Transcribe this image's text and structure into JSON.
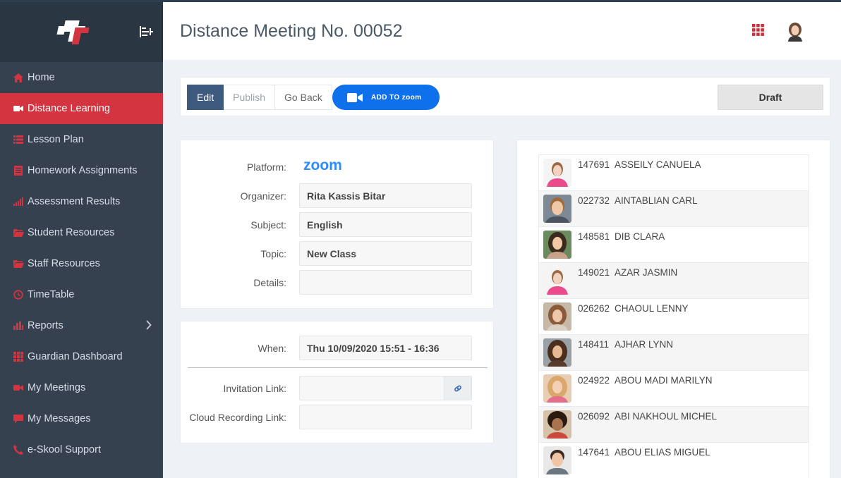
{
  "sidebar": {
    "items": [
      {
        "label": "Home",
        "icon": "home-icon"
      },
      {
        "label": "Distance Learning",
        "icon": "video-camera-icon",
        "active": true
      },
      {
        "label": "Lesson Plan",
        "icon": "list-icon"
      },
      {
        "label": "Homework Assignments",
        "icon": "document-icon"
      },
      {
        "label": "Assessment Results",
        "icon": "signal-bars-icon"
      },
      {
        "label": "Student Resources",
        "icon": "folder-icon"
      },
      {
        "label": "Staff Resources",
        "icon": "folder-icon"
      },
      {
        "label": "TimeTable",
        "icon": "clock-icon"
      },
      {
        "label": "Reports",
        "icon": "bar-chart-icon",
        "has_submenu": true
      },
      {
        "label": "Guardian Dashboard",
        "icon": "grid-icon"
      },
      {
        "label": "My Meetings",
        "icon": "video-camera-icon"
      },
      {
        "label": "My Messages",
        "icon": "chat-bubble-icon"
      },
      {
        "label": "e-Skool Support",
        "icon": "phone-icon"
      }
    ]
  },
  "header": {
    "title": "Distance Meeting No. 00052"
  },
  "toolbar": {
    "edit_label": "Edit",
    "publish_label": "Publish",
    "goback_label": "Go Back",
    "zoom_label": "ADD TO zoom",
    "status_label": "Draft"
  },
  "details": {
    "platform_label": "Platform:",
    "platform_value": "zoom",
    "organizer_label": "Organizer:",
    "organizer_value": "Rita Kassis Bitar",
    "subject_label": "Subject:",
    "subject_value": "English",
    "topic_label": "Topic:",
    "topic_value": "New Class",
    "details_label": "Details:",
    "details_value": ""
  },
  "schedule": {
    "when_label": "When:",
    "when_value": "Thu 10/09/2020 15:51 - 16:36",
    "invitation_label": "Invitation Link:",
    "invitation_value": "",
    "recording_label": "Cloud Recording Link:",
    "recording_value": ""
  },
  "students": [
    {
      "id": "147691",
      "name": "ASSEILY CANUELA"
    },
    {
      "id": "022732",
      "name": "AINTABLIAN CARL"
    },
    {
      "id": "148581",
      "name": "DIB CLARA"
    },
    {
      "id": "149021",
      "name": "AZAR JASMIN"
    },
    {
      "id": "026262",
      "name": "CHAOUL LENNY"
    },
    {
      "id": "148411",
      "name": "AJHAR LYNN"
    },
    {
      "id": "024922",
      "name": "ABOU MADI MARILYN"
    },
    {
      "id": "026092",
      "name": "ABI NAKHOUL MICHEL"
    },
    {
      "id": "147641",
      "name": "ABOU ELIAS MIGUEL"
    }
  ],
  "colors": {
    "sidebar_bg": "#364150",
    "brand_bg": "#2b3643",
    "accent_red": "#d3343f",
    "primary_btn": "#3e5a7e",
    "zoom_blue": "#0e71eb"
  }
}
